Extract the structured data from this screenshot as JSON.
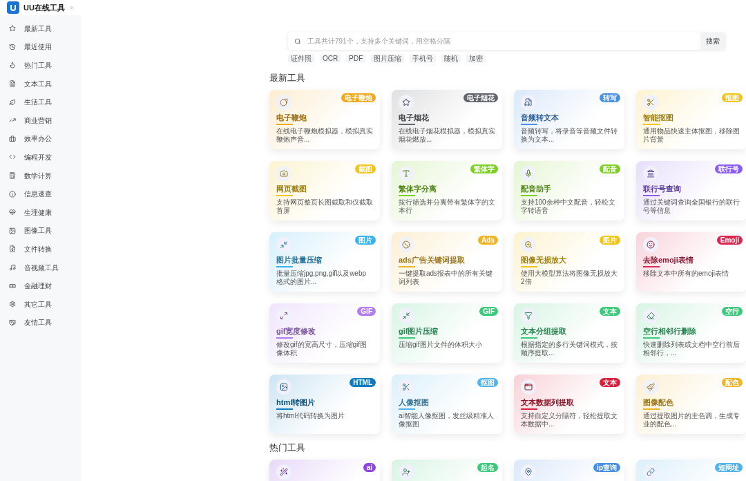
{
  "app": {
    "title": "UU在线工具"
  },
  "sidebar": {
    "items": [
      {
        "label": "最新工具"
      },
      {
        "label": "最近使用"
      },
      {
        "label": "热门工具"
      },
      {
        "label": "文本工具"
      },
      {
        "label": "生活工具"
      },
      {
        "label": "商业营销"
      },
      {
        "label": "效率办公"
      },
      {
        "label": "编程开发"
      },
      {
        "label": "数学计算"
      },
      {
        "label": "信息速查"
      },
      {
        "label": "生理健康"
      },
      {
        "label": "图像工具"
      },
      {
        "label": "文件转换"
      },
      {
        "label": "音视频工具"
      },
      {
        "label": "金融理财"
      },
      {
        "label": "其它工具"
      },
      {
        "label": "友情工具"
      }
    ]
  },
  "search": {
    "placeholder": "工具共计791个，支持多个关键词，用空格分隔",
    "button": "搜索",
    "tags": [
      "证件照",
      "OCR",
      "PDF",
      "图片压缩",
      "手机号",
      "随机",
      "加密"
    ]
  },
  "sections": [
    {
      "title": "最新工具",
      "cards": [
        {
          "title": "电子鞭炮",
          "desc": "在线电子鞭炮模拟器，模拟真实鞭炮声音...",
          "badge": "电子鞭炮",
          "color": "#f0a81c"
        },
        {
          "title": "电子烟花",
          "desc": "在线电子烟花模拟器，模拟真实烟花燃放...",
          "badge": "电子烟花",
          "color": "#63666d"
        },
        {
          "title": "音频转文本",
          "desc": "音频转写，将录音等音频文件转换为文本...",
          "badge": "转写",
          "color": "#4a90e2"
        },
        {
          "title": "智能抠图",
          "desc": "通用物品快速主体抠图，移除图片背景",
          "badge": "抠图",
          "color": "#f2c318"
        },
        {
          "title": "网页截图",
          "desc": "支持网页整页长图截取和仅截取首屏",
          "badge": "截图",
          "color": "#f2c318"
        },
        {
          "title": "繁体字分离",
          "desc": "按行筛选并分离带有繁体字的文本行",
          "badge": "繁体字",
          "color": "#7ccf23"
        },
        {
          "title": "配音助手",
          "desc": "支持100余种中文配音，轻松文字转语音",
          "badge": "配音",
          "color": "#7ccf23"
        },
        {
          "title": "联行号查询",
          "desc": "通过关键词查询全国银行的联行号等信息",
          "badge": "联行号",
          "color": "#8a5cf0"
        },
        {
          "title": "图片批量压缩",
          "desc": "批量压缩jpg,png,gif以及webp格式的图片...",
          "badge": "图片",
          "color": "#36b2ee"
        },
        {
          "title": "ads广告关键词提取",
          "desc": "一键提取ads报表中的所有关键词列表",
          "badge": "Ads",
          "color": "#f0b429"
        },
        {
          "title": "图像无损放大",
          "desc": "使用大模型算法将图像无损放大2倍",
          "badge": "图片",
          "color": "#f2c318"
        },
        {
          "title": "去除emoji表情",
          "desc": "移除文本中所有的emoji表情",
          "badge": "Emoji",
          "color": "#dc2650"
        },
        {
          "title": "gif宽度修改",
          "desc": "修改gif的宽高尺寸，压缩gif图像体积",
          "badge": "GIF",
          "color": "#b57cf0"
        },
        {
          "title": "gif图片压缩",
          "desc": "压缩gif图片文件的体积大小",
          "badge": "GIF",
          "color": "#3cc97a"
        },
        {
          "title": "文本分组提取",
          "desc": "根据指定的多行关键词模式，按顺序提取...",
          "badge": "文本",
          "color": "#3cc97a"
        },
        {
          "title": "空行相邻行删除",
          "desc": "快速删除列表或文档中空行前后相邻行，...",
          "badge": "空行",
          "color": "#3cc97a"
        },
        {
          "title": "html转图片",
          "desc": "将html代码转换为图片",
          "badge": "HTML",
          "color": "#0a7cc1"
        },
        {
          "title": "人像抠图",
          "desc": "ai智能人像抠图，发丝级精准人像抠图",
          "badge": "抠图",
          "color": "#4fb3e8"
        },
        {
          "title": "文本数据列提取",
          "desc": "支持自定义分隔符，轻松提取文本数据中...",
          "badge": "文本",
          "color": "#d81f3c"
        },
        {
          "title": "图像配色",
          "desc": "通过提取图片的主色调，生成专业的配色...",
          "badge": "配色",
          "color": "#f0b429"
        }
      ]
    },
    {
      "title": "热门工具",
      "cards": [
        {
          "badge": "ai",
          "color": "#8e44e0"
        },
        {
          "badge": "起名",
          "color": "#3cc97a"
        },
        {
          "badge": "ip查询",
          "color": "#4a90e2"
        },
        {
          "badge": "短网址",
          "color": "#4fb3e8"
        }
      ]
    }
  ]
}
